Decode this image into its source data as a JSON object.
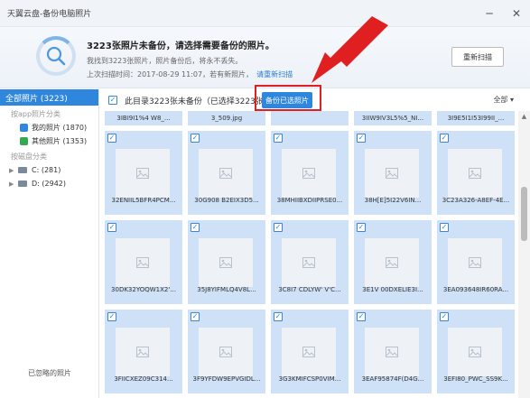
{
  "window": {
    "title": "天翼云盘-备份电脑照片",
    "min": "─",
    "close": "✕"
  },
  "header": {
    "headline": "3223张照片未备份，请选择需要备份的照片。",
    "subtitle": "我找到3223张照片，照片备份后，将永不丢失。",
    "last_scan": "上次扫描时间：2017-08-29 11:07，若有新照片，",
    "rescan_link": "请重新扫描",
    "rescan_button": "重新扫描"
  },
  "sidebar": {
    "all_label": "全部照片 (3223)",
    "section_app": "按app照片分类",
    "items": [
      {
        "label": "我的照片 (1870)",
        "color": "#2f86dd",
        "icon": "camera-icon"
      },
      {
        "label": "其他照片 (1353)",
        "color": "#35a852",
        "icon": "image-icon"
      }
    ],
    "section_disk": "按磁盘分类",
    "drives": [
      {
        "label": "C: (281)"
      },
      {
        "label": "D: (2942)"
      }
    ],
    "footer": "已忽略的照片"
  },
  "toolbar": {
    "message": "此目录3223张未备份（已选择3223张）",
    "backup_button": "备份已选照片",
    "filter": "全部"
  },
  "grid": {
    "top_partial": [
      "3IBI9I1%4 W8_...",
      "3_509.jpg",
      "",
      "3IIW9IV3L5%5_NI...",
      "3I9E5I1I53I99II_..."
    ],
    "rows": [
      [
        "32ENIIL5BFR4PCM...",
        "30G908 B2EIX3D5...",
        "38MHIIBXDIIPRSE0...",
        "38H[E]5I22V6IN...",
        "3C23A326-A8EF-4E..."
      ],
      [
        "30DK32YOQW1X2'...",
        "35J8YIFMLQ4V8L...",
        "3C8I7 CDLYW' V'C...",
        "3E1V 00DXELIE3I...",
        "3EA093648IR60RA..."
      ],
      [
        "3FIICXEZ09C314...",
        "3F9YFDW9EPVGIDL...",
        "3G3KMIFCSP0VIM...",
        "3EAF95874F(D4G...",
        "3EFI80_PWC_SS9K..."
      ]
    ]
  }
}
